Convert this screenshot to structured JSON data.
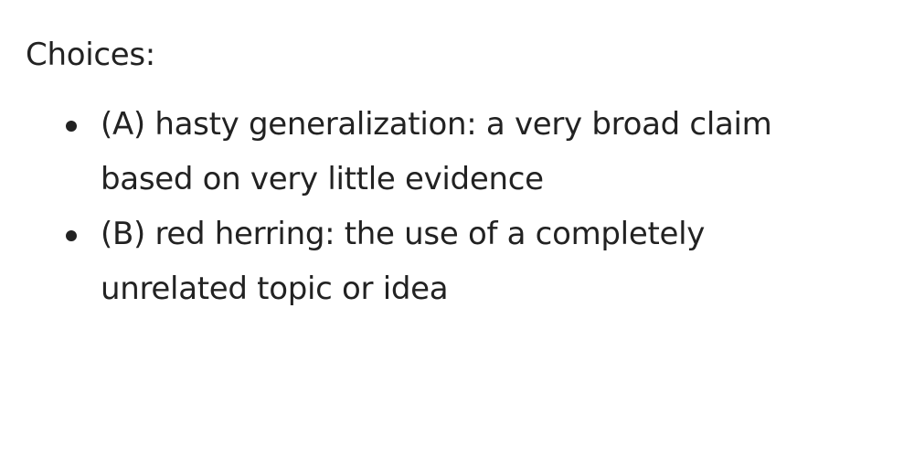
{
  "heading": "Choices:",
  "choices": [
    {
      "label": "(A) hasty generalization: a very broad claim based on very little evidence"
    },
    {
      "label": "(B) red herring: the use of a completely unrelated topic or idea"
    }
  ]
}
